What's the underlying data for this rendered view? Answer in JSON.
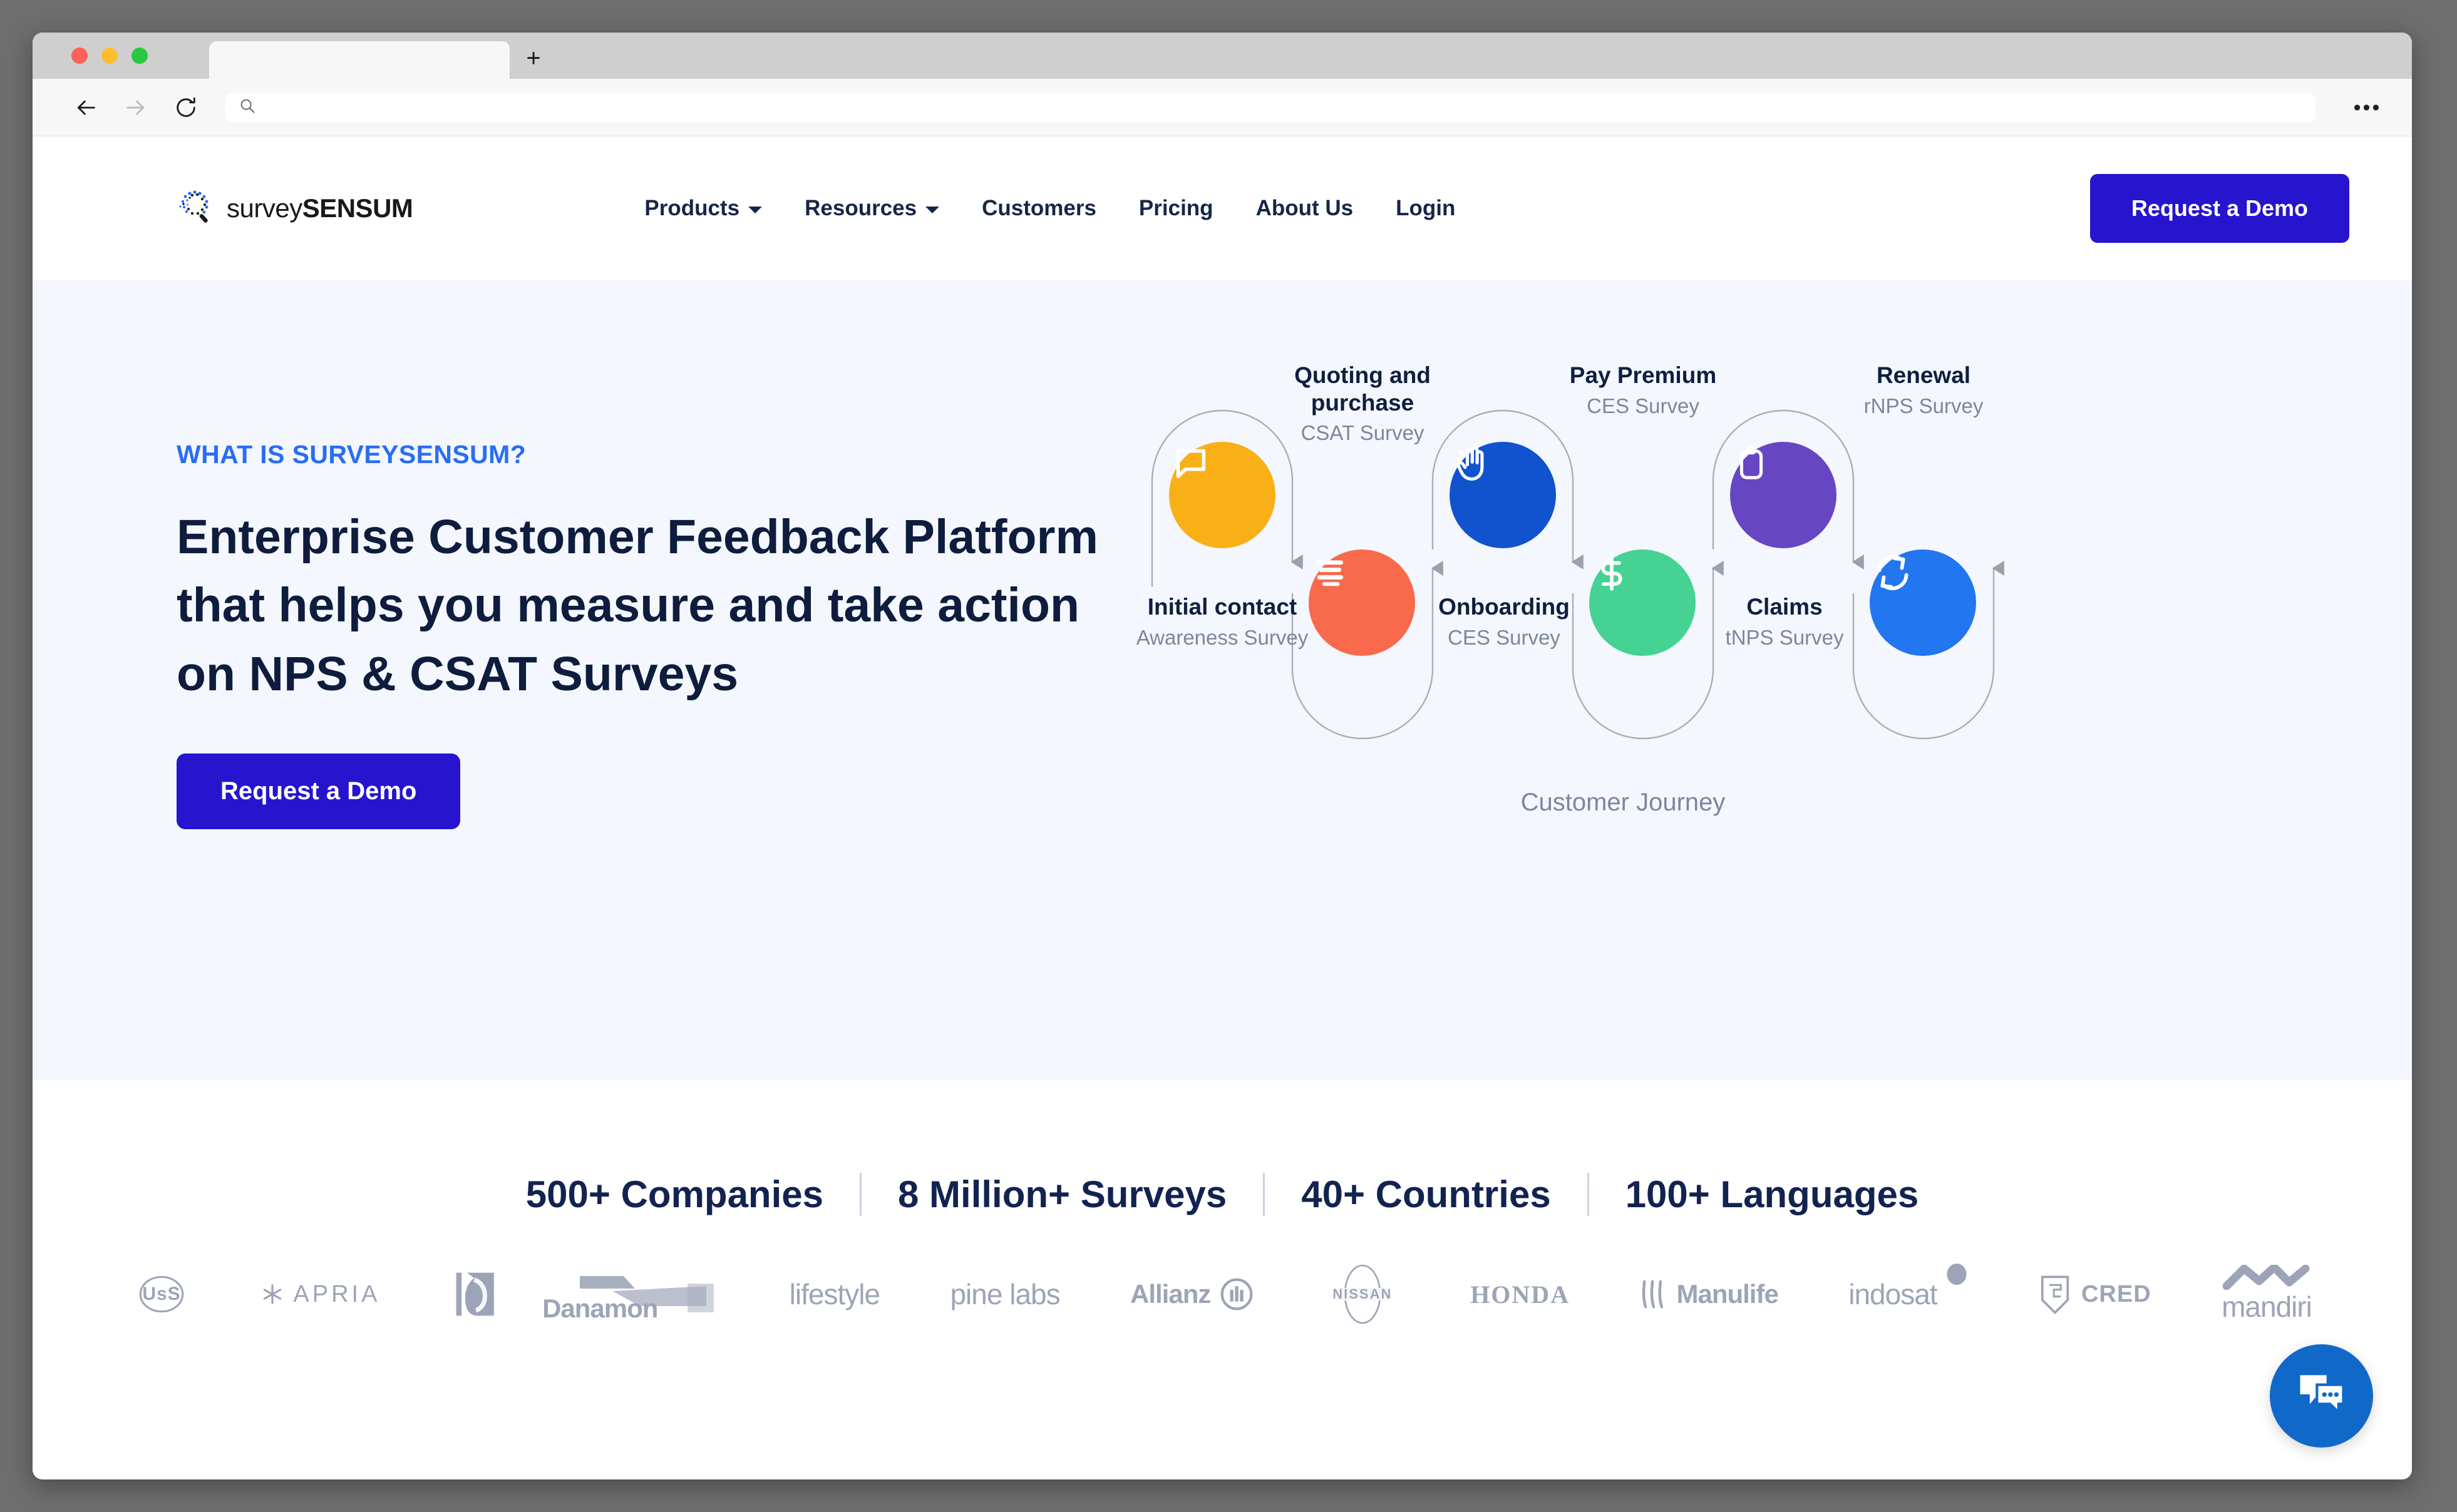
{
  "browser": {
    "tab_title": "",
    "url_value": "",
    "url_placeholder": "",
    "back_icon": "back-arrow-icon",
    "forward_icon": "forward-arrow-icon",
    "reload_icon": "reload-icon",
    "search_icon": "search-icon",
    "new_tab_label": "+",
    "overflow_label": "•••"
  },
  "header": {
    "logo_light": "survey",
    "logo_bold": "SENSUM",
    "nav": [
      {
        "label": "Products",
        "has_chevron": true
      },
      {
        "label": "Resources",
        "has_chevron": true
      },
      {
        "label": "Customers",
        "has_chevron": false
      },
      {
        "label": "Pricing",
        "has_chevron": false
      },
      {
        "label": "About Us",
        "has_chevron": false
      },
      {
        "label": "Login",
        "has_chevron": false
      }
    ],
    "cta_label": "Request a Demo"
  },
  "hero": {
    "eyebrow": "WHAT IS SURVEYSENSUM?",
    "title": "Enterprise Customer Feedback Platform that helps you measure and take action on NPS & CSAT Surveys",
    "cta_label": "Request a Demo",
    "bg_color": "#f4f7fe",
    "accent_color": "#2614cf",
    "eyebrow_color": "#2a6df4"
  },
  "journey": {
    "caption": "Customer Journey",
    "nodes": [
      {
        "title": "Initial contact",
        "subtitle": "Awareness Survey",
        "color": "#f9b017",
        "icon": "chat-bubble-icon",
        "position": "top"
      },
      {
        "title": "Quoting and purchase",
        "subtitle": "CSAT Survey",
        "color": "#f96a4d",
        "icon": "text-lines-icon",
        "position": "bottom"
      },
      {
        "title": "Onboarding",
        "subtitle": "CES Survey",
        "color": "#1152ce",
        "icon": "waving-hand-icon",
        "position": "top"
      },
      {
        "title": "Pay Premium",
        "subtitle": "CES Survey",
        "color": "#45d292",
        "icon": "dollar-icon",
        "position": "bottom"
      },
      {
        "title": "Claims",
        "subtitle": "tNPS Survey",
        "color": "#6746c3",
        "icon": "clipboard-icon",
        "position": "top"
      },
      {
        "title": "Renewal",
        "subtitle": "rNPS Survey",
        "color": "#2276f0",
        "icon": "refresh-icon",
        "position": "bottom"
      }
    ]
  },
  "stats": [
    "500+ Companies",
    "8 Million+ Surveys",
    "40+ Countries",
    "100+ Languages"
  ],
  "logos": [
    {
      "name": "UsS",
      "style": "tiny"
    },
    {
      "name": "APRIA",
      "style": "thin"
    },
    {
      "name": "",
      "style": "mark"
    },
    {
      "name": "Danamon",
      "style": "round"
    },
    {
      "name": "lifestyle",
      "style": "script"
    },
    {
      "name": "pine labs",
      "style": "script"
    },
    {
      "name": "Allianz",
      "style": "round"
    },
    {
      "name": "NISSAN",
      "style": "tiny"
    },
    {
      "name": "HONDA",
      "style": "serif"
    },
    {
      "name": "Manulife",
      "style": "round"
    },
    {
      "name": "indosat",
      "style": "script"
    },
    {
      "name": "CRED",
      "style": "wm"
    },
    {
      "name": "mandiri",
      "style": "script"
    }
  ],
  "chat": {
    "icon": "chat-bubbles-icon",
    "color": "#1069c9"
  }
}
